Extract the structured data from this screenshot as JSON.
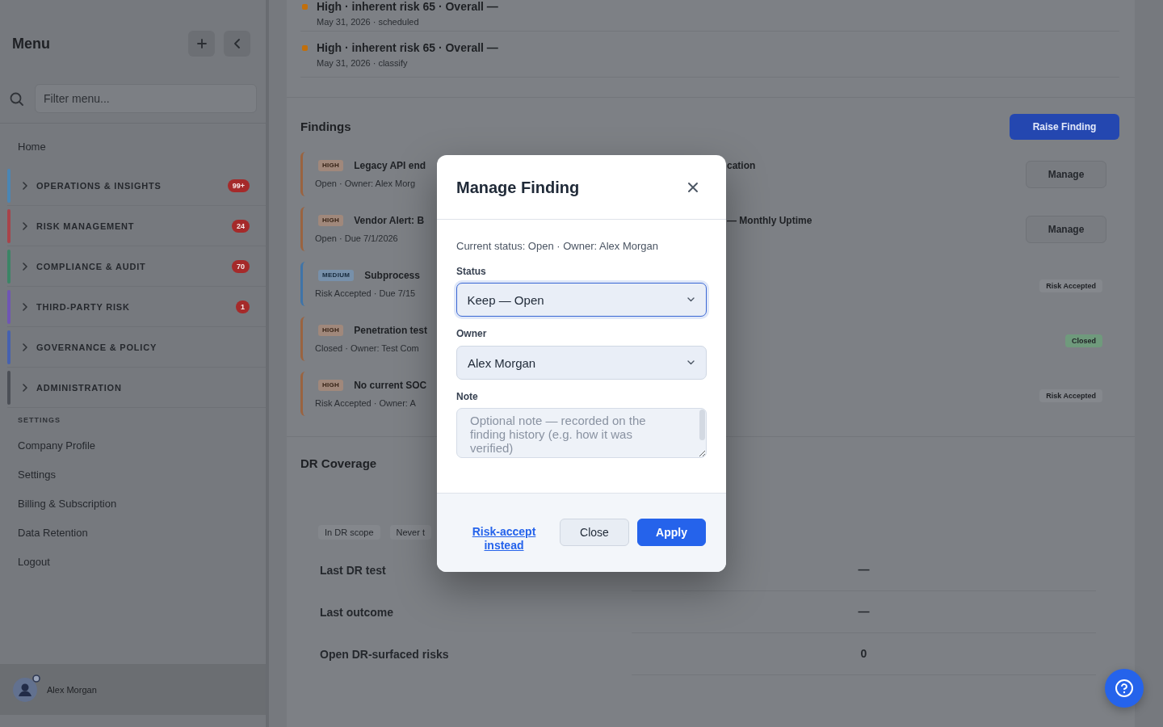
{
  "sidebar": {
    "title": "Menu",
    "search": {
      "placeholder": "Filter menu..."
    },
    "home": "Home",
    "groups": [
      {
        "label": "OPERATIONS & INSIGHTS",
        "color": "#4a86b5",
        "badge": "99+",
        "expanded": false
      },
      {
        "label": "RISK MANAGEMENT",
        "color": "#a8434a",
        "badge": "24",
        "expanded": false
      },
      {
        "label": "COMPLIANCE & AUDIT",
        "color": "#3b8566",
        "badge": "70",
        "expanded": false
      },
      {
        "label": "THIRD-PARTY RISK",
        "color": "#6f55b5",
        "badge": "1",
        "expanded": false
      },
      {
        "label": "GOVERNANCE & POLICY",
        "color": "#4661b0",
        "expanded": false
      },
      {
        "label": "ADMINISTRATION",
        "color": "#4b4f56",
        "expanded": false
      }
    ],
    "settings_heading": "SETTINGS",
    "settings_items": [
      "Company Profile",
      "Settings",
      "Billing & Subscription",
      "Data Retention",
      "Logout"
    ],
    "user": {
      "name": "Alex Morgan"
    }
  },
  "activity": [
    {
      "title": "High · inherent risk 65 · Overall —",
      "meta": "May 31, 2026 · scheduled",
      "color": "#c26f0b"
    },
    {
      "title": "High · inherent risk 65 · Overall —",
      "meta": "May 31, 2026 · classify",
      "color": "#c26f0b"
    }
  ],
  "findings": {
    "title": "Findings",
    "raise_button": "Raise Finding",
    "rows": [
      {
        "severity": "HIGH",
        "color": "#9a6340",
        "title": "Legacy API end",
        "title_tail": "cation",
        "meta": "Open · Owner: Alex Morg",
        "action": {
          "kind": "button",
          "label": "Manage"
        }
      },
      {
        "severity": "HIGH",
        "color": "#9a6340",
        "title": "Vendor Alert: B",
        "title_tail": "— Monthly Uptime",
        "meta": "Open · Due 7/1/2026",
        "action": {
          "kind": "button",
          "label": "Manage"
        }
      },
      {
        "severity": "MEDIUM",
        "color": "#3f74a8",
        "title": "Subprocess",
        "meta": "Risk Accepted · Due 7/15",
        "action": {
          "kind": "tag",
          "label": "Risk Accepted",
          "color": "#85888d"
        }
      },
      {
        "severity": "HIGH",
        "color": "#9a6340",
        "title": "Penetration test",
        "meta": "Closed · Owner: Test Com",
        "action": {
          "kind": "tag",
          "label": "Closed",
          "color": "#6f9a7c"
        }
      },
      {
        "severity": "HIGH",
        "color": "#9a6340",
        "title": "No current SOC",
        "meta": "Risk Accepted · Owner: A",
        "action": {
          "kind": "tag",
          "label": "Risk Accepted",
          "color": "#85888d"
        }
      }
    ]
  },
  "dr_coverage": {
    "title": "DR Coverage",
    "chips": [
      "In DR scope",
      "Never t"
    ],
    "rows": [
      {
        "label": "Last DR test",
        "value": "—"
      },
      {
        "label": "Last outcome",
        "value": "—"
      },
      {
        "label": "Open DR-surfaced risks",
        "value": "0"
      }
    ]
  },
  "modal": {
    "title": "Manage Finding",
    "summary": "Current status: Open · Owner: Alex Morgan",
    "fields": [
      {
        "kind": "select",
        "label": "Status",
        "value": "Keep — Open",
        "focused": true
      },
      {
        "kind": "select",
        "label": "Owner",
        "value": "Alex Morgan",
        "focused": false
      },
      {
        "kind": "textarea",
        "label": "Note",
        "placeholder": "Optional note — recorded on the finding history (e.g. how it was verified)"
      }
    ],
    "link": "Risk-accept instead",
    "buttons": [
      {
        "label": "Close",
        "kind": "secondary"
      },
      {
        "label": "Apply",
        "kind": "primary"
      }
    ]
  }
}
